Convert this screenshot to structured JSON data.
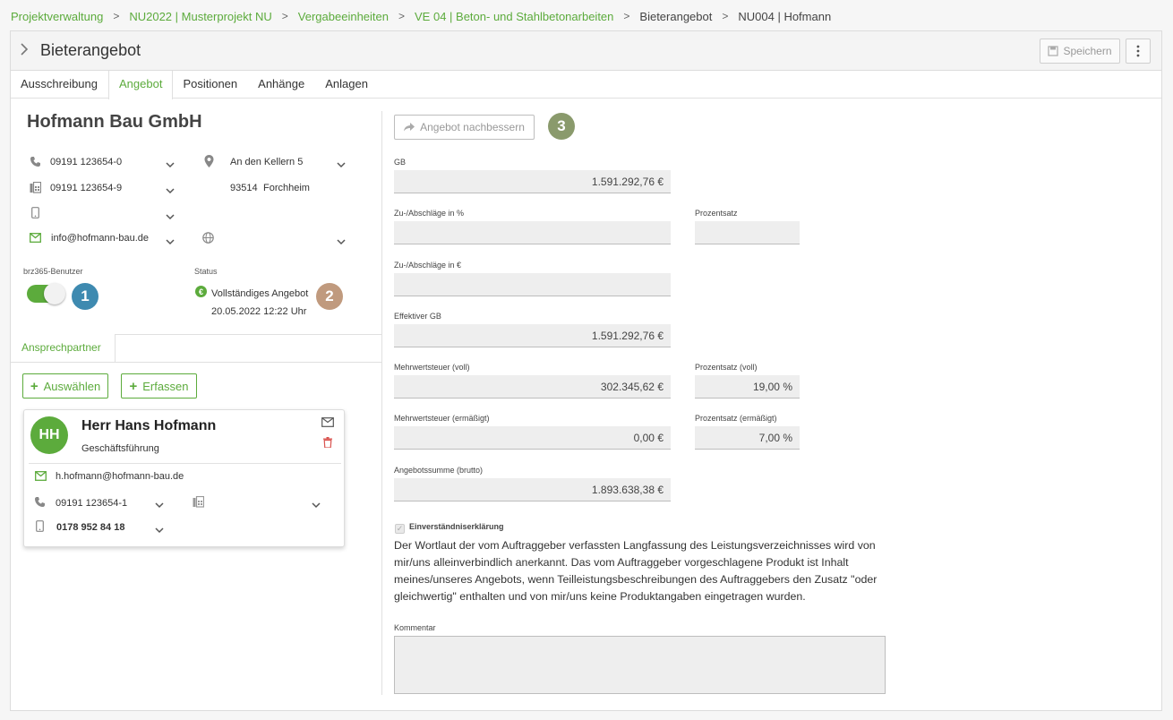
{
  "breadcrumb": {
    "items": [
      "Projektverwaltung",
      "NU2022 | Musterprojekt NU",
      "Vergabeeinheiten",
      "VE 04 | Beton- und Stahlbetonarbeiten",
      "Bieterangebot",
      "NU004 | Hofmann"
    ]
  },
  "header": {
    "title": "Bieterangebot",
    "save_label": "Speichern"
  },
  "tabs": [
    "Ausschreibung",
    "Angebot",
    "Positionen",
    "Anhänge",
    "Anlagen"
  ],
  "active_tab": "Angebot",
  "company": {
    "name": "Hofmann Bau GmbH",
    "phone": "09191 123654-0",
    "fax": "09191 123654-9",
    "mobile": "",
    "email": "info@hofmann-bau.de",
    "street": "An den Kellern 5",
    "zip": "93514",
    "city": "Forchheim",
    "website": ""
  },
  "user_section": {
    "label": "brz365-Benutzer",
    "enabled": true,
    "badge": "1"
  },
  "status": {
    "label": "Status",
    "text": "Vollständiges Angebot",
    "date": "20.05.2022 12:22 Uhr",
    "badge": "2"
  },
  "contacts": {
    "tab_label": "Ansprechpartner",
    "select_label": "Auswählen",
    "create_label": "Erfassen",
    "card": {
      "initials": "HH",
      "name": "Herr Hans Hofmann",
      "role": "Geschäftsführung",
      "email": "h.hofmann@hofmann-bau.de",
      "phone": "09191 123654-1",
      "mobile": "0178 952 84 18"
    }
  },
  "offer": {
    "improve_label": "Angebot nachbessern",
    "badge": "3",
    "fields": {
      "gb": {
        "label": "GB",
        "value": "1.591.292,76 €"
      },
      "adj_pct": {
        "label": "Zu-/Abschläge in %",
        "value": ""
      },
      "pct": {
        "label": "Prozentsatz",
        "value": ""
      },
      "adj_eur": {
        "label": "Zu-/Abschläge in €",
        "value": ""
      },
      "eff_gb": {
        "label": "Effektiver GB",
        "value": "1.591.292,76 €"
      },
      "vat_full": {
        "label": "Mehrwertsteuer (voll)",
        "value": "302.345,62 €"
      },
      "vat_full_pct": {
        "label": "Prozentsatz (voll)",
        "value": "19,00 %"
      },
      "vat_red": {
        "label": "Mehrwertsteuer (ermäßigt)",
        "value": "0,00 €"
      },
      "vat_red_pct": {
        "label": "Prozentsatz (ermäßigt)",
        "value": "7,00 %"
      },
      "total": {
        "label": "Angebotssumme (brutto)",
        "value": "1.893.638,38 €"
      }
    },
    "consent": {
      "title": "Einverständniserklärung",
      "text": "Der Wortlaut der vom Auftraggeber verfassten Langfassung des Leistungsverzeichnisses wird von mir/uns alleinverbindlich anerkannt. Das vom Auftraggeber vorgeschlagene Produkt ist Inhalt meines/unseres Angebots, wenn Teilleistungsbeschreibungen des Auftraggebers den Zusatz \"oder gleichwertig\" enthalten und von mir/uns keine Produktangaben eingetragen wurden."
    },
    "comment": {
      "label": "Kommentar",
      "value": ""
    }
  },
  "colors": {
    "accent": "#5cab3c",
    "badge1": "#3e8ab0",
    "badge2": "#c09a7e",
    "badge3": "#8a9a6c",
    "delete": "#d9534f"
  }
}
